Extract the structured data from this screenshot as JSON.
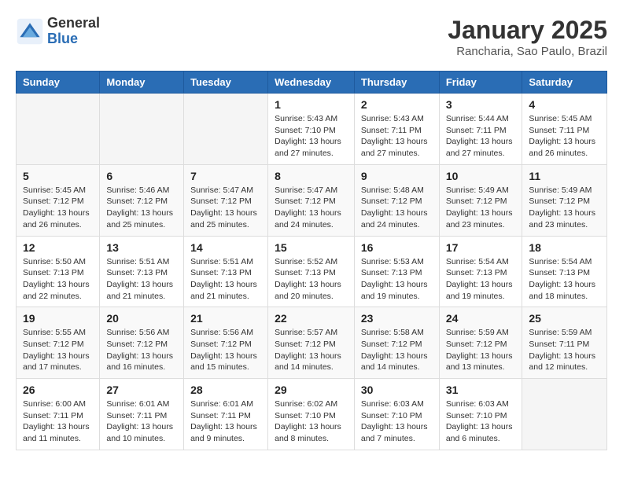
{
  "header": {
    "logo": {
      "general": "General",
      "blue": "Blue"
    },
    "title": "January 2025",
    "subtitle": "Rancharia, Sao Paulo, Brazil"
  },
  "days_of_week": [
    "Sunday",
    "Monday",
    "Tuesday",
    "Wednesday",
    "Thursday",
    "Friday",
    "Saturday"
  ],
  "weeks": [
    [
      {
        "day": "",
        "info": ""
      },
      {
        "day": "",
        "info": ""
      },
      {
        "day": "",
        "info": ""
      },
      {
        "day": "1",
        "info": "Sunrise: 5:43 AM\nSunset: 7:10 PM\nDaylight: 13 hours\nand 27 minutes."
      },
      {
        "day": "2",
        "info": "Sunrise: 5:43 AM\nSunset: 7:11 PM\nDaylight: 13 hours\nand 27 minutes."
      },
      {
        "day": "3",
        "info": "Sunrise: 5:44 AM\nSunset: 7:11 PM\nDaylight: 13 hours\nand 27 minutes."
      },
      {
        "day": "4",
        "info": "Sunrise: 5:45 AM\nSunset: 7:11 PM\nDaylight: 13 hours\nand 26 minutes."
      }
    ],
    [
      {
        "day": "5",
        "info": "Sunrise: 5:45 AM\nSunset: 7:12 PM\nDaylight: 13 hours\nand 26 minutes."
      },
      {
        "day": "6",
        "info": "Sunrise: 5:46 AM\nSunset: 7:12 PM\nDaylight: 13 hours\nand 25 minutes."
      },
      {
        "day": "7",
        "info": "Sunrise: 5:47 AM\nSunset: 7:12 PM\nDaylight: 13 hours\nand 25 minutes."
      },
      {
        "day": "8",
        "info": "Sunrise: 5:47 AM\nSunset: 7:12 PM\nDaylight: 13 hours\nand 24 minutes."
      },
      {
        "day": "9",
        "info": "Sunrise: 5:48 AM\nSunset: 7:12 PM\nDaylight: 13 hours\nand 24 minutes."
      },
      {
        "day": "10",
        "info": "Sunrise: 5:49 AM\nSunset: 7:12 PM\nDaylight: 13 hours\nand 23 minutes."
      },
      {
        "day": "11",
        "info": "Sunrise: 5:49 AM\nSunset: 7:12 PM\nDaylight: 13 hours\nand 23 minutes."
      }
    ],
    [
      {
        "day": "12",
        "info": "Sunrise: 5:50 AM\nSunset: 7:13 PM\nDaylight: 13 hours\nand 22 minutes."
      },
      {
        "day": "13",
        "info": "Sunrise: 5:51 AM\nSunset: 7:13 PM\nDaylight: 13 hours\nand 21 minutes."
      },
      {
        "day": "14",
        "info": "Sunrise: 5:51 AM\nSunset: 7:13 PM\nDaylight: 13 hours\nand 21 minutes."
      },
      {
        "day": "15",
        "info": "Sunrise: 5:52 AM\nSunset: 7:13 PM\nDaylight: 13 hours\nand 20 minutes."
      },
      {
        "day": "16",
        "info": "Sunrise: 5:53 AM\nSunset: 7:13 PM\nDaylight: 13 hours\nand 19 minutes."
      },
      {
        "day": "17",
        "info": "Sunrise: 5:54 AM\nSunset: 7:13 PM\nDaylight: 13 hours\nand 19 minutes."
      },
      {
        "day": "18",
        "info": "Sunrise: 5:54 AM\nSunset: 7:13 PM\nDaylight: 13 hours\nand 18 minutes."
      }
    ],
    [
      {
        "day": "19",
        "info": "Sunrise: 5:55 AM\nSunset: 7:12 PM\nDaylight: 13 hours\nand 17 minutes."
      },
      {
        "day": "20",
        "info": "Sunrise: 5:56 AM\nSunset: 7:12 PM\nDaylight: 13 hours\nand 16 minutes."
      },
      {
        "day": "21",
        "info": "Sunrise: 5:56 AM\nSunset: 7:12 PM\nDaylight: 13 hours\nand 15 minutes."
      },
      {
        "day": "22",
        "info": "Sunrise: 5:57 AM\nSunset: 7:12 PM\nDaylight: 13 hours\nand 14 minutes."
      },
      {
        "day": "23",
        "info": "Sunrise: 5:58 AM\nSunset: 7:12 PM\nDaylight: 13 hours\nand 14 minutes."
      },
      {
        "day": "24",
        "info": "Sunrise: 5:59 AM\nSunset: 7:12 PM\nDaylight: 13 hours\nand 13 minutes."
      },
      {
        "day": "25",
        "info": "Sunrise: 5:59 AM\nSunset: 7:11 PM\nDaylight: 13 hours\nand 12 minutes."
      }
    ],
    [
      {
        "day": "26",
        "info": "Sunrise: 6:00 AM\nSunset: 7:11 PM\nDaylight: 13 hours\nand 11 minutes."
      },
      {
        "day": "27",
        "info": "Sunrise: 6:01 AM\nSunset: 7:11 PM\nDaylight: 13 hours\nand 10 minutes."
      },
      {
        "day": "28",
        "info": "Sunrise: 6:01 AM\nSunset: 7:11 PM\nDaylight: 13 hours\nand 9 minutes."
      },
      {
        "day": "29",
        "info": "Sunrise: 6:02 AM\nSunset: 7:10 PM\nDaylight: 13 hours\nand 8 minutes."
      },
      {
        "day": "30",
        "info": "Sunrise: 6:03 AM\nSunset: 7:10 PM\nDaylight: 13 hours\nand 7 minutes."
      },
      {
        "day": "31",
        "info": "Sunrise: 6:03 AM\nSunset: 7:10 PM\nDaylight: 13 hours\nand 6 minutes."
      },
      {
        "day": "",
        "info": ""
      }
    ]
  ]
}
